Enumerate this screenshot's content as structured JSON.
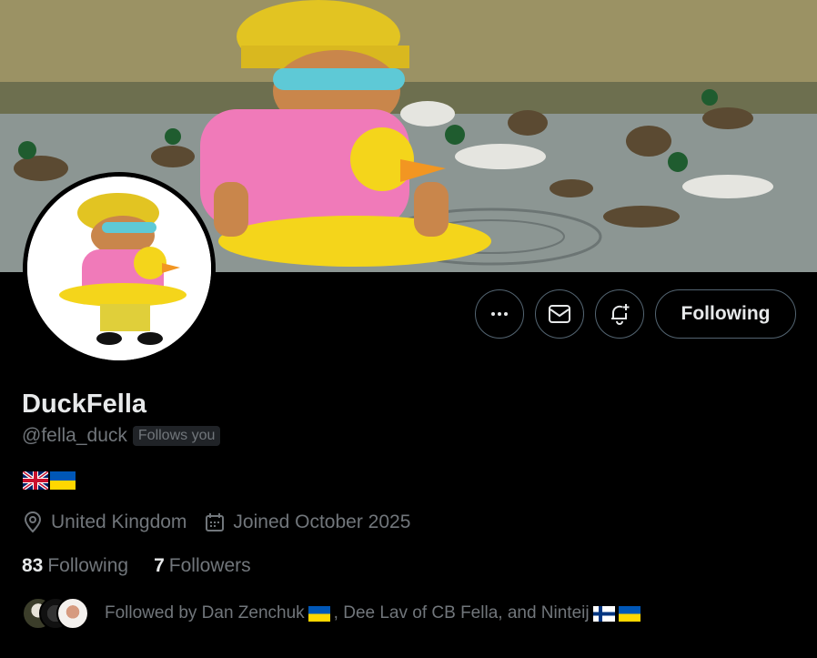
{
  "profile": {
    "display_name": "DuckFella",
    "handle": "@fella_duck",
    "follows_you_badge": "Follows you",
    "bio_flags": [
      "uk-flag",
      "ukraine-flag"
    ],
    "location": "United Kingdom",
    "joined": "Joined October 2025"
  },
  "actions": {
    "more_icon": "more-dots-icon",
    "message_icon": "envelope-icon",
    "notify_icon": "bell-plus-icon",
    "follow_label": "Following"
  },
  "stats": {
    "following_count": "83",
    "following_label": "Following",
    "followers_count": "7",
    "followers_label": "Followers"
  },
  "followed_by": {
    "part1": "Followed by Dan Zenchuk",
    "part2": ", Dee Lav of CB Fella, and Ninteij"
  },
  "colors": {
    "background": "#000000",
    "text_primary": "#e7e9ea",
    "text_secondary": "#71767b",
    "border": "#536471"
  }
}
